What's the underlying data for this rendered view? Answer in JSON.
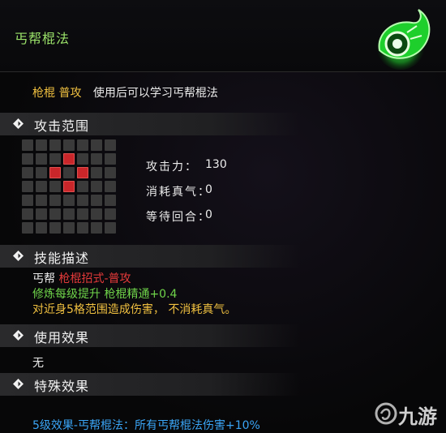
{
  "header": {
    "title": "丐帮棍法"
  },
  "description": {
    "category": "枪棍 普攻",
    "text": "使用后可以学习丐帮棍法"
  },
  "sections": {
    "attack_range": "攻击范围",
    "skill_desc": "技能描述",
    "use_effect": "使用效果",
    "special_effect": "特殊效果"
  },
  "range_grid": {
    "size": 7,
    "hit_cells": [
      [
        1,
        3
      ],
      [
        2,
        2
      ],
      [
        2,
        4
      ],
      [
        3,
        3
      ]
    ]
  },
  "stats": [
    {
      "label": "攻击力：",
      "value": "130"
    },
    {
      "label": "消耗真气：",
      "value": "0"
    },
    {
      "label": "等待回合：",
      "value": "0"
    }
  ],
  "skill": {
    "line1_prefix": "丐帮 ",
    "line1_highlight": "枪棍招式-普攻",
    "line2": "修炼每级提升 枪棍精通+0.4",
    "line3": "对近身5格范围造成伤害， 不消耗真气。"
  },
  "use_effect_text": "无",
  "special_bonus": "5级效果-丐帮棍法：所有丐帮棍法伤害+10%",
  "watermark": {
    "text": "九游"
  },
  "colors": {
    "title": "#9be36a",
    "gold": "#f0c040",
    "red": "#e53a3a",
    "green": "#6fd44a",
    "blue": "#3aa4f5",
    "emblem": "#22dd33"
  }
}
